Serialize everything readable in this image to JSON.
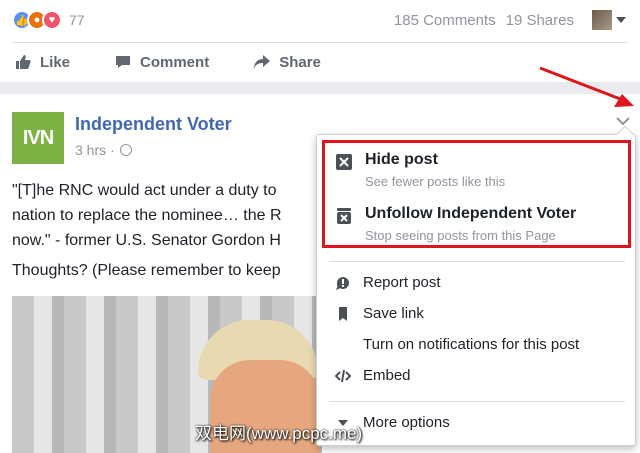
{
  "stats": {
    "reaction_count": "77",
    "comments": "185 Comments",
    "shares": "19 Shares"
  },
  "actions": {
    "like": "Like",
    "comment": "Comment",
    "share": "Share"
  },
  "post": {
    "logo_text_a": "I",
    "logo_text_b": "V",
    "logo_text_c": "N",
    "page_name": "Independent Voter",
    "time": "3 hrs",
    "dot": "·",
    "lines": [
      "\"[T]he RNC would act under a duty to",
      "nation to replace the nominee… the R",
      "now.\" - former U.S. Senator Gordon H"
    ],
    "question": "Thoughts? (Please remember to keep"
  },
  "menu": {
    "hide_title": "Hide post",
    "hide_sub": "See fewer posts like this",
    "unfollow_title": "Unfollow Independent Voter",
    "unfollow_sub": "Stop seeing posts from this Page",
    "report": "Report post",
    "save": "Save link",
    "notifications": "Turn on notifications for this post",
    "embed": "Embed",
    "more": "More options"
  },
  "watermark": "双电网(www.pcpc.me)",
  "colors": {
    "link_blue": "#4267b2",
    "highlight_red": "#e0141d",
    "ivn_green": "#7cb342"
  }
}
